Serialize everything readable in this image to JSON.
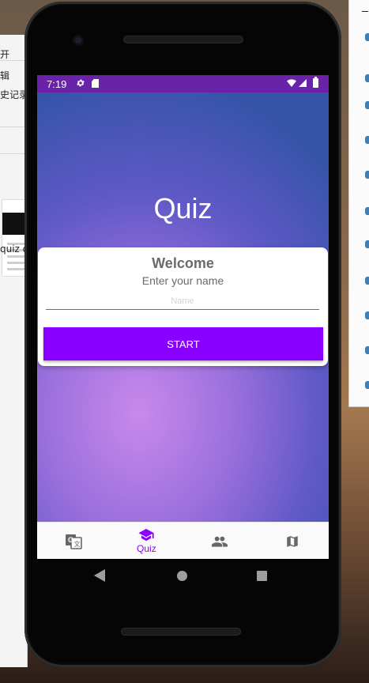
{
  "desktop": {
    "left_window_lines": [
      "开",
      "辑",
      "史记录",
      "quiz d"
    ],
    "colors": {
      "accent_blue": "#3d7fb6"
    }
  },
  "device": {
    "status_bar": {
      "time": "7:19",
      "icons": [
        "gear-icon",
        "sd-card-icon",
        "wifi-icon",
        "signal-icon",
        "battery-icon"
      ],
      "color": "#6a22a8"
    },
    "app": {
      "title": "Quiz",
      "card": {
        "heading": "Welcome",
        "subtitle": "Enter your name",
        "name_placeholder": "Name",
        "name_value": "",
        "start_label": "START"
      },
      "accent_color": "#8800ff",
      "bottom_nav": [
        {
          "id": "translate",
          "label": "",
          "icon": "translate-icon",
          "selected": false
        },
        {
          "id": "quiz",
          "label": "Quiz",
          "icon": "school-icon",
          "selected": true
        },
        {
          "id": "people",
          "label": "",
          "icon": "people-icon",
          "selected": false
        },
        {
          "id": "map",
          "label": "",
          "icon": "map-icon",
          "selected": false
        }
      ]
    },
    "system_nav": [
      "back-icon",
      "home-icon",
      "recents-icon"
    ]
  }
}
